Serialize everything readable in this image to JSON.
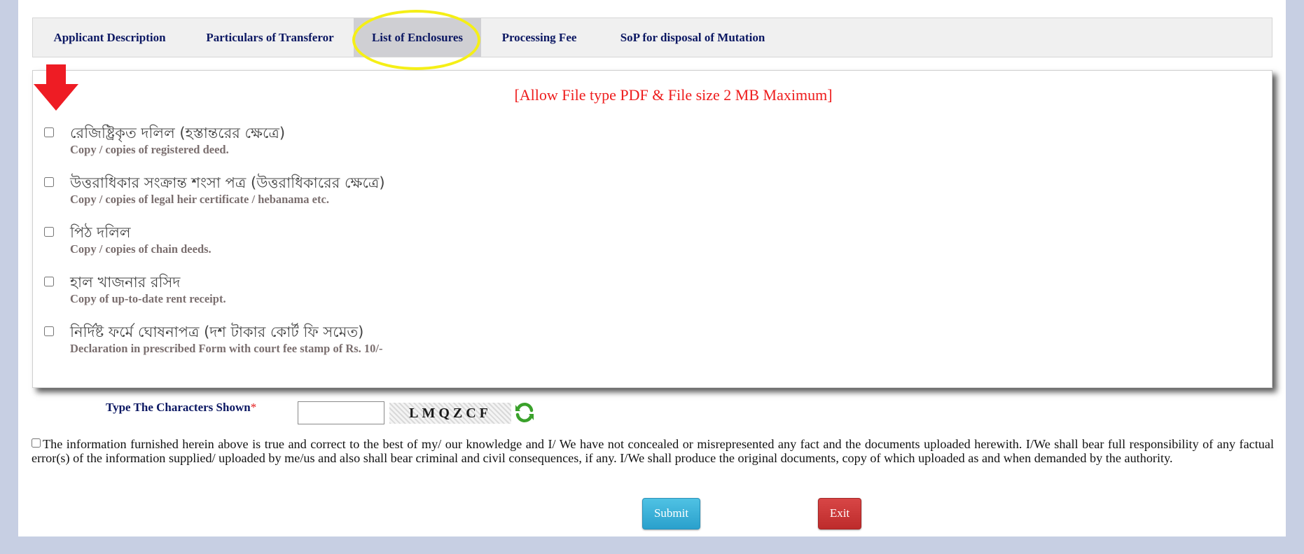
{
  "tabs": [
    {
      "label": "Applicant Description",
      "active": false
    },
    {
      "label": "Particulars of Transferor",
      "active": false
    },
    {
      "label": "List of Enclosures",
      "active": true
    },
    {
      "label": "Processing Fee",
      "active": false
    },
    {
      "label": "SoP for disposal of Mutation",
      "active": false
    }
  ],
  "panel": {
    "notice": "[Allow File type PDF & File size 2 MB Maximum]",
    "items": [
      {
        "bn": "রেজিষ্ট্রিকৃত দলিল (হস্তান্তরের ক্ষেত্রে)",
        "en": "Copy / copies of registered deed.",
        "checked": false
      },
      {
        "bn": "উত্তরাধিকার সংক্রান্ত শংসা পত্র (উত্তরাধিকারের ক্ষেত্রে)",
        "en": "Copy / copies of legal heir certificate / hebanama etc.",
        "checked": false
      },
      {
        "bn": "পিঠ দলিল",
        "en": "Copy / copies of chain deeds.",
        "checked": false
      },
      {
        "bn": "হাল খাজনার রসিদ",
        "en": "Copy of up-to-date rent receipt.",
        "checked": false
      },
      {
        "bn": "নির্দিষ্ট ফর্মে ঘোষনাপত্র (দশ টাকার কোর্ট ফি সমেত)",
        "en": "Declaration in prescribed Form with court fee stamp of Rs. 10/-",
        "checked": false
      }
    ]
  },
  "captcha": {
    "label": "Type The Characters Shown",
    "required_mark": "*",
    "value": "",
    "image_text": "LMQZCF"
  },
  "declaration": {
    "text": "The information furnished herein above is true and correct to the best of my/ our knowledge and I/ We have not concealed or misrepresented any fact and the documents uploaded herewith. I/We shall bear full responsibility of any factual error(s) of the information supplied/ uploaded by me/us and also shall bear criminal and civil consequences, if any. I/We shall produce the original documents, copy of which uploaded as and when demanded by the authority.",
    "checked": false
  },
  "buttons": {
    "submit": "Submit",
    "exit": "Exit"
  },
  "colors": {
    "tab_text": "#0b1762",
    "notice": "#ee1c1c",
    "arrow": "#ee1c24",
    "highlight": "#f5ef16",
    "submit": "#2aa0cc",
    "exit": "#bd2b2b",
    "refresh": "#3aa12b"
  }
}
